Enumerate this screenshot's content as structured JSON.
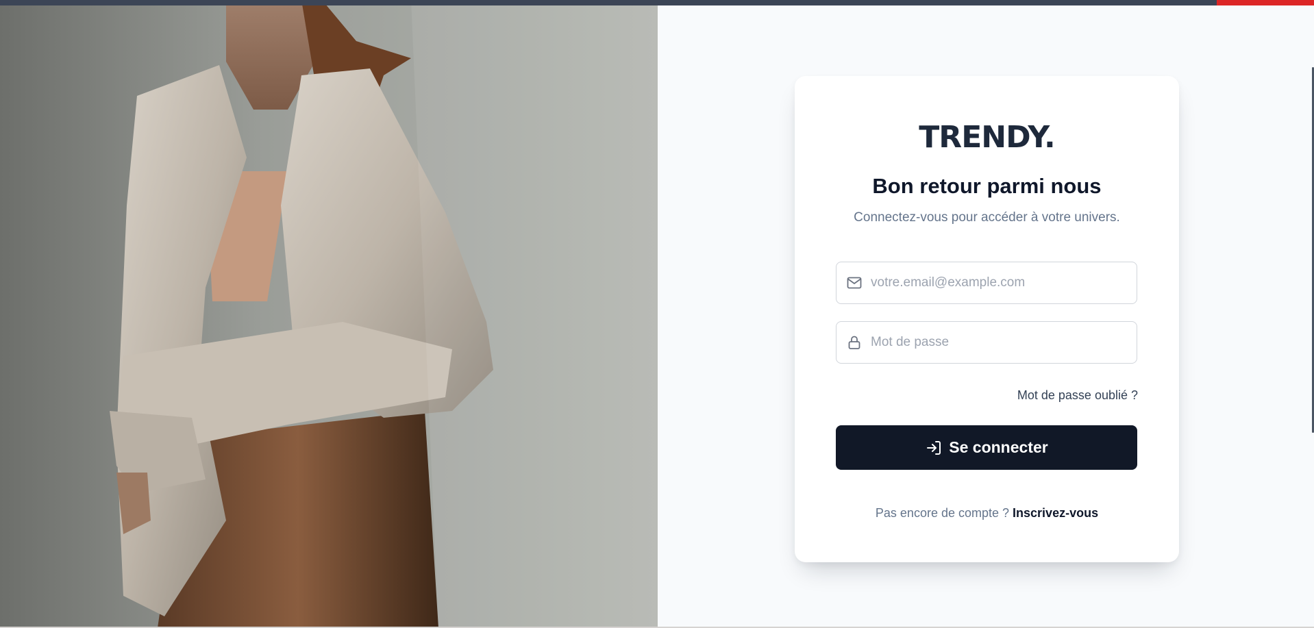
{
  "hero": {
    "image_alt": "woman-in-linen-shirt-photo"
  },
  "brand": {
    "logo_text": "TRENDY."
  },
  "login": {
    "title": "Bon retour parmi nous",
    "subtitle": "Connectez-vous pour accéder à votre univers.",
    "email": {
      "placeholder": "votre.email@example.com",
      "value": "",
      "icon": "mail-icon"
    },
    "password": {
      "placeholder": "Mot de passe",
      "value": "",
      "icon": "lock-icon"
    },
    "forgot_password_label": "Mot de passe oublié ?",
    "submit": {
      "label": "Se connecter",
      "icon": "log-in-icon"
    },
    "signup_prompt": "Pas encore de compte ?",
    "signup_link_label": "Inscrivez-vous"
  },
  "colors": {
    "primary": "#111827",
    "page_bg": "#f8fafc",
    "top_bar": "#3c4556",
    "top_bar_accent": "#dc2626",
    "muted_text": "#64748b"
  }
}
